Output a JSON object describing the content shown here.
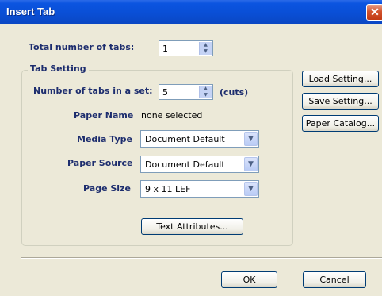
{
  "window": {
    "title": "Insert Tab",
    "close_glyph": "✕"
  },
  "total_tabs": {
    "label": "Total number of tabs:",
    "value": "1"
  },
  "tab_setting": {
    "group_title": "Tab Setting",
    "tabs_in_set": {
      "label": "Number of tabs in a set:",
      "value": "5",
      "unit": "(cuts)"
    },
    "paper_name": {
      "label": "Paper Name",
      "value": "none selected"
    },
    "media_type": {
      "label": "Media Type",
      "value": "Document Default"
    },
    "paper_source": {
      "label": "Paper Source",
      "value": "Document Default"
    },
    "page_size": {
      "label": "Page Size",
      "value": "9 x 11 LEF"
    },
    "text_attributes_button": "Text Attributes..."
  },
  "side_buttons": {
    "load_setting": "Load Setting...",
    "save_setting": "Save Setting...",
    "paper_catalog": "Paper Catalog..."
  },
  "footer": {
    "ok": "OK",
    "cancel": "Cancel"
  },
  "icons": {
    "spin_up": "▲",
    "spin_down": "▼",
    "dropdown": "▼"
  },
  "colors": {
    "titlebar": "#0a4fd6",
    "dialog_bg": "#ece9d8",
    "label_text": "#1d2d6e",
    "close_button": "#d2532d"
  }
}
